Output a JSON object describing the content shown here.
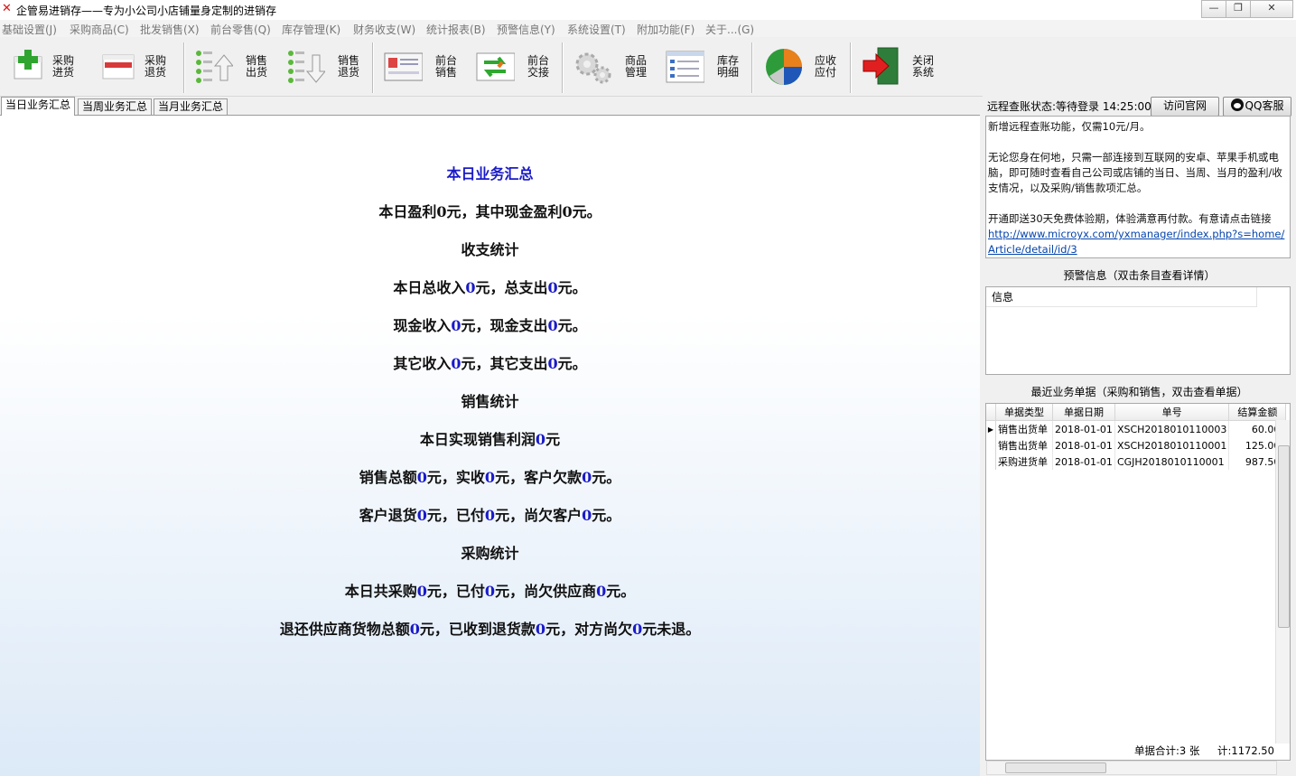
{
  "window": {
    "title": "企管易进销存——专为小公司小店铺量身定制的进销存",
    "min_label": "—",
    "max_label": "❐",
    "close_label": "✕"
  },
  "menu": [
    "基础设置(J)",
    "采购商品(C)",
    "批发销售(X)",
    "前台零售(Q)",
    "库存管理(K)",
    "财务收支(W)",
    "统计报表(B)",
    "预警信息(Y)",
    "系统设置(T)",
    "附加功能(F)",
    "关于...(G)"
  ],
  "toolbar": [
    {
      "label": "采购\n进货",
      "icon": "add-purchase-icon"
    },
    {
      "label": "采购\n退货",
      "icon": "purchase-return-icon"
    },
    {
      "label": "销售\n出货",
      "icon": "sales-out-icon"
    },
    {
      "label": "销售\n退货",
      "icon": "sales-return-icon"
    },
    {
      "label": "前台\n销售",
      "icon": "pos-sale-icon"
    },
    {
      "label": "前台\n交接",
      "icon": "handover-icon"
    },
    {
      "label": "商品\n管理",
      "icon": "gear-icon"
    },
    {
      "label": "库存\n明细",
      "icon": "stock-list-icon"
    },
    {
      "label": "应收\n应付",
      "icon": "pie-chart-icon"
    },
    {
      "label": "关闭\n系统",
      "icon": "exit-icon"
    }
  ],
  "tabs": [
    "当日业务汇总",
    "当周业务汇总",
    "当月业务汇总"
  ],
  "summary": {
    "title": "本日业务汇总",
    "profit": {
      "a": "本日盈利",
      "v1": "0",
      "b": "元，其中现金盈利",
      "v2": "0",
      "c": "元。"
    },
    "income_title": "收支统计",
    "total": {
      "a": "本日总收入",
      "v1": "0",
      "b": "元，总支出",
      "v2": "0",
      "c": "元。"
    },
    "cash": {
      "a": "现金收入",
      "v1": "0",
      "b": "元，现金支出",
      "v2": "0",
      "c": "元。"
    },
    "other": {
      "a": "其它收入",
      "v1": "0",
      "b": "元，其它支出",
      "v2": "0",
      "c": "元。"
    },
    "sales_title": "销售统计",
    "sales_profit": {
      "a": "本日实现销售利润",
      "v1": "0",
      "b": "元"
    },
    "sales_total": {
      "a": "销售总额",
      "v1": "0",
      "b": "元，实收",
      "v2": "0",
      "c": "元，客户欠款",
      "v3": "0",
      "d": "元。"
    },
    "sales_return": {
      "a": "客户退货",
      "v1": "0",
      "b": "元，已付",
      "v2": "0",
      "c": "元，尚欠客户",
      "v3": "0",
      "d": "元。"
    },
    "purchase_title": "采购统计",
    "purchase": {
      "a": "本日共采购",
      "v1": "0",
      "b": "元，已付",
      "v2": "0",
      "c": "元，尚欠供应商",
      "v3": "0",
      "d": "元。"
    },
    "purchase_return": {
      "a": "退还供应商货物总额",
      "v1": "0",
      "b": "元，已收到退货款",
      "v2": "0",
      "c": "元，对方尚欠",
      "v3": "0",
      "d": "元未退。"
    }
  },
  "right": {
    "status": "远程查账状态:等待登录 14:25:00",
    "visit_site": "访问官网",
    "qq_service": "QQ客服",
    "notice": {
      "p1": "新增远程查账功能，仅需10元/月。",
      "p2": "无论您身在何地，只需一部连接到互联网的安卓、苹果手机或电脑，即可随时查看自己公司或店铺的当日、当周、当月的盈利/收支情况，以及采购/销售款项汇总。",
      "p3": "开通即送30天免费体验期，体验满意再付款。有意请点击链接",
      "link": "http://www.microyx.com/yxmanager/index.php?s=home/Article/detail/id/3"
    },
    "warn_title": "预警信息（双击条目查看详情）",
    "warn_col": "信息",
    "docs_title": "最近业务单据（采购和销售，双击查看单据）",
    "docs_cols": [
      "单据类型",
      "单据日期",
      "单号",
      "结算金额"
    ],
    "docs": [
      [
        "销售出货单",
        "2018-01-01",
        "XSCH2018010110003",
        "60.00"
      ],
      [
        "销售出货单",
        "2018-01-01",
        "XSCH2018010110001",
        "125.00"
      ],
      [
        "采购进货单",
        "2018-01-01",
        "CGJH2018010110001",
        "987.50"
      ]
    ],
    "row_indicator": "▶",
    "sum_count": "单据合计:3 张",
    "sum_total": "计:1172.50"
  }
}
